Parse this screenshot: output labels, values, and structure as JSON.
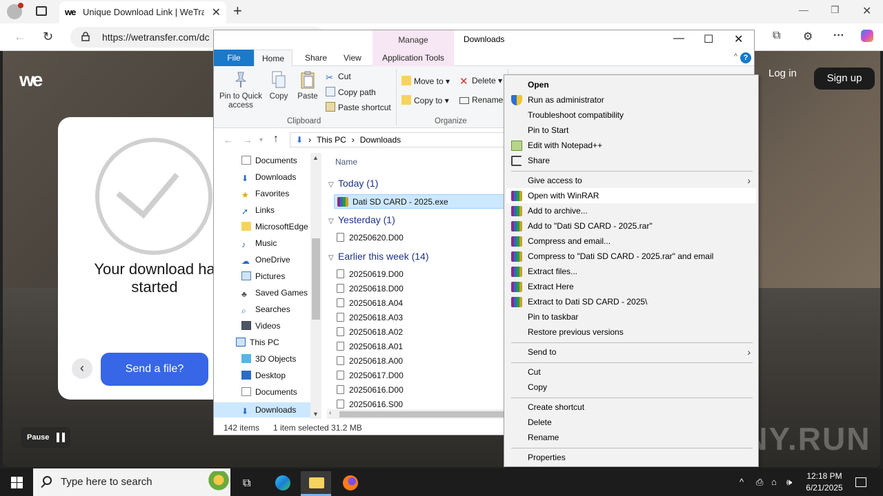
{
  "browser": {
    "tab_title": "Unique Download Link | WeTransf",
    "tab_favicon": "we",
    "url": "https://wetransfer.com/dc",
    "window_controls": [
      "minimize",
      "restore",
      "close"
    ]
  },
  "page": {
    "logo": "we",
    "download_message": "Your download ha started",
    "back_symbol": "‹",
    "send_button": "Send a file?",
    "pause_label": "Pause",
    "login": "Log in",
    "signup": "Sign up",
    "watermark": "ANY.RUN"
  },
  "explorer": {
    "manage_label": "Manage",
    "window_title": "Downloads",
    "tabs": {
      "file": "File",
      "home": "Home",
      "share": "Share",
      "view": "View",
      "app_tools": "Application Tools"
    },
    "help": "?",
    "ribbon": {
      "pin": "Pin to Quick access",
      "copy": "Copy",
      "paste": "Paste",
      "cut": "Cut",
      "copy_path": "Copy path",
      "paste_shortcut": "Paste shortcut",
      "clipboard_group": "Clipboard",
      "move_to": "Move to",
      "copy_to": "Copy to",
      "delete": "Delete",
      "rename": "Rename",
      "organize_group": "Organize"
    },
    "breadcrumb": [
      "This PC",
      "Downloads"
    ],
    "nav_items": [
      "Documents",
      "Downloads",
      "Favorites",
      "Links",
      "MicrosoftEdge",
      "Music",
      "OneDrive",
      "Pictures",
      "Saved Games",
      "Searches",
      "Videos",
      "This PC",
      "3D Objects",
      "Desktop",
      "Documents",
      "Downloads"
    ],
    "column_name": "Name",
    "groups": {
      "today": "Today (1)",
      "yesterday": "Yesterday (1)",
      "week": "Earlier this week (14)"
    },
    "files_today": [
      "Dati SD CARD - 2025.exe"
    ],
    "files_yesterday": [
      "20250620.D00"
    ],
    "files_week": [
      "20250619.D00",
      "20250618.D00",
      "20250618.A04",
      "20250618.A03",
      "20250618.A02",
      "20250618.A01",
      "20250618.A00",
      "20250617.D00",
      "20250616.D00",
      "20250616.S00"
    ],
    "status": {
      "items": "142 items",
      "selected": "1 item selected  31.2 MB"
    }
  },
  "context_menu": {
    "items": [
      "Open",
      "Run as administrator",
      "Troubleshoot compatibility",
      "Pin to Start",
      "Edit with Notepad++",
      "Share",
      "Give access to",
      "Open with WinRAR",
      "Add to archive...",
      "Add to \"Dati SD CARD - 2025.rar\"",
      "Compress and email...",
      "Compress to \"Dati SD CARD - 2025.rar\" and email",
      "Extract files...",
      "Extract Here",
      "Extract to Dati SD CARD - 2025\\",
      "Pin to taskbar",
      "Restore previous versions",
      "Send to",
      "Cut",
      "Copy",
      "Create shortcut",
      "Delete",
      "Rename",
      "Properties"
    ]
  },
  "taskbar": {
    "search_placeholder": "Type here to search",
    "time": "12:18 PM",
    "date": "6/21/2025"
  },
  "colors": {
    "accent": "#1979ca",
    "send_button": "#3767e6",
    "selection": "#cce8ff",
    "manage_tab": "#f7e6f3"
  }
}
